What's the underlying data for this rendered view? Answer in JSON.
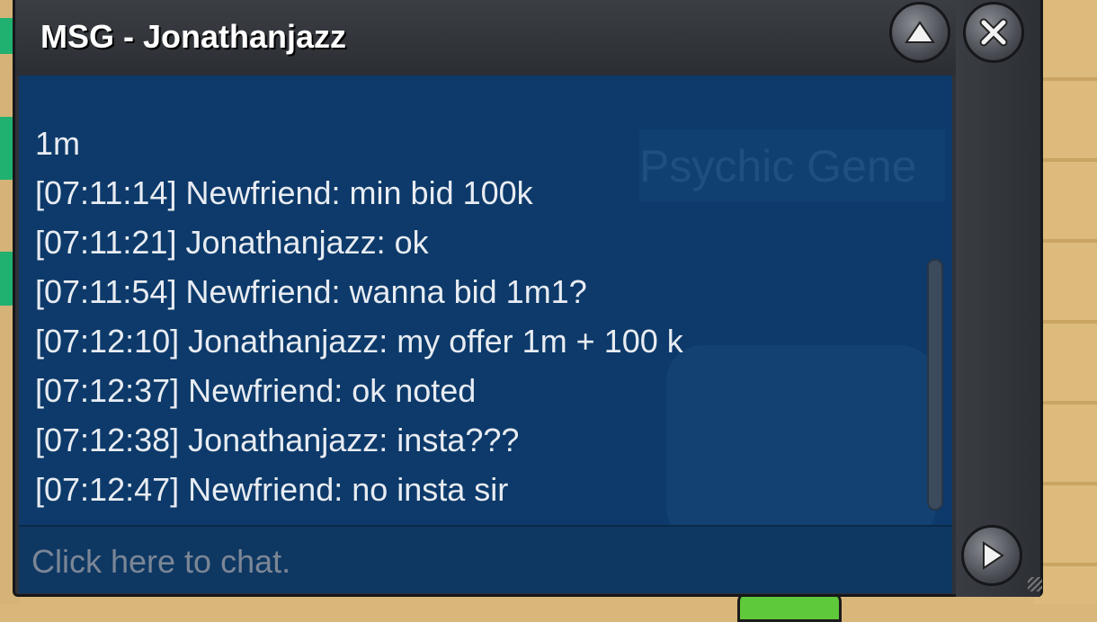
{
  "window": {
    "title": "MSG - Jonathanjazz",
    "up_icon": "chevron-up-icon",
    "close_icon": "close-icon",
    "send_icon": "play-arrow-icon"
  },
  "messages": [
    "1m",
    "[07:11:14] Newfriend: min bid 100k",
    "[07:11:21] Jonathanjazz: ok",
    "[07:11:54] Newfriend: wanna bid 1m1?",
    "[07:12:10] Jonathanjazz: my offer 1m + 100 k",
    "[07:12:37] Newfriend: ok noted",
    "[07:12:38] Jonathanjazz: insta???",
    "[07:12:47] Newfriend: no insta sir"
  ],
  "background_text": "Psychic Gene",
  "input": {
    "placeholder": "Click here to chat."
  },
  "colors": {
    "message_bg": "#0d3a6a",
    "frame": "#2f3238",
    "text": "#e8ecf2"
  }
}
